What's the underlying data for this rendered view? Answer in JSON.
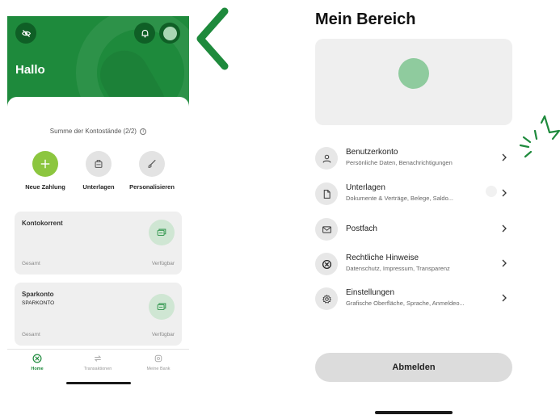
{
  "left_screen": {
    "greeting": "Hallo",
    "summary_label": "Summe der Kontostände (2/2)",
    "summary_info_glyph": "i",
    "actions": [
      {
        "label": "Neue Zahlung",
        "icon": "plus-icon"
      },
      {
        "label": "Unterlagen",
        "icon": "briefcase-icon"
      },
      {
        "label": "Personalisieren",
        "icon": "brush-icon"
      }
    ],
    "accounts": [
      {
        "name": "Kontokorrent",
        "subtitle": "",
        "total_label": "Gesamt",
        "available_label": "Verfügbar"
      },
      {
        "name": "Sparkonto",
        "subtitle": "SPARKONTO",
        "total_label": "Gesamt",
        "available_label": "Verfügbar"
      }
    ],
    "nav": [
      {
        "label": "Home",
        "icon": "home-icon",
        "active": true
      },
      {
        "label": "Transaktionen",
        "icon": "transfer-arrows-icon",
        "active": false
      },
      {
        "label": "Meine Bank",
        "icon": "bank-icon",
        "active": false
      }
    ]
  },
  "right_screen": {
    "title": "Mein Bereich",
    "menu": [
      {
        "title": "Benutzerkonto",
        "subtitle": "Persönliche Daten, Benachrichtigungen",
        "icon": "user-icon"
      },
      {
        "title": "Unterlagen",
        "subtitle": "Dokumente & Verträge, Belege, Saldo...",
        "icon": "document-icon"
      },
      {
        "title": "Postfach",
        "subtitle": "",
        "icon": "mail-icon"
      },
      {
        "title": "Rechtliche Hinweise",
        "subtitle": "Datenschutz, Impressum, Transparenz",
        "icon": "legal-icon"
      },
      {
        "title": "Einstellungen",
        "subtitle": "Grafische Oberfläche, Sprache, Anmeldeo...",
        "icon": "gear-icon"
      }
    ],
    "logout_label": "Abmelden"
  },
  "colors": {
    "brand_green": "#1e8a3c",
    "dark_green": "#0f5f26",
    "lime": "#8cc63f",
    "avatar_green": "#8fcb9e"
  }
}
